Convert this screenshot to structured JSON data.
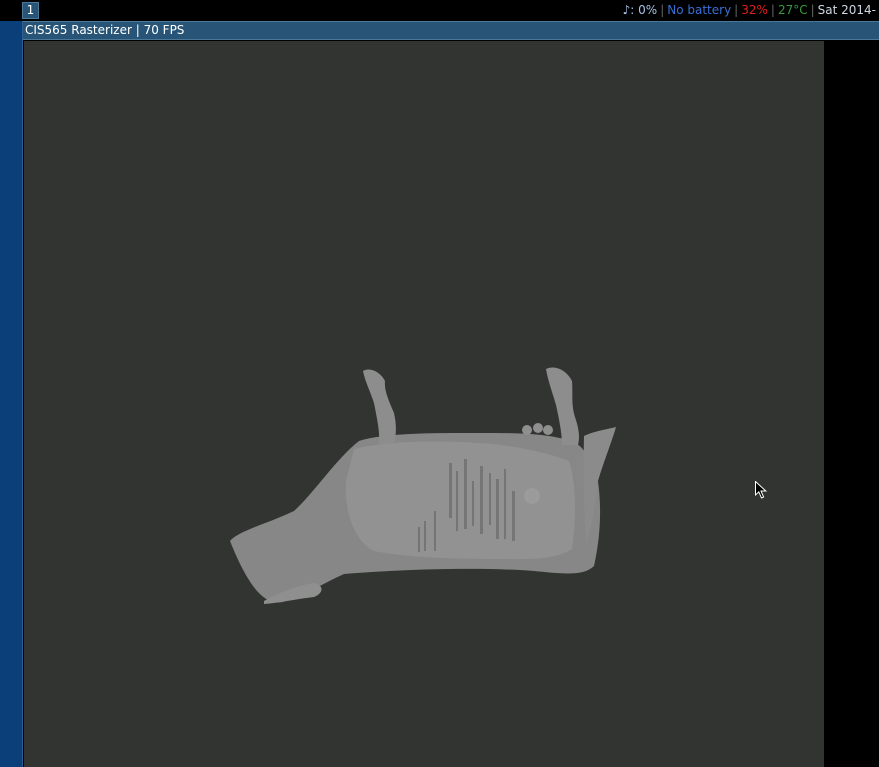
{
  "bar": {
    "workspace_label": "1",
    "status": {
      "volume": "♪: 0%",
      "battery": "No battery",
      "cpu": "32%",
      "temp": "27°C",
      "datetime": "Sat 2014-"
    },
    "colors": {
      "volume": "#a8c4e8",
      "battery": "#3a6fd8",
      "cpu": "#e0201e",
      "temp": "#3a9a3a",
      "datetime": "#cfd8e3"
    }
  },
  "window": {
    "title": "CIS565 Rasterizer | 70 FPS"
  },
  "icons": {
    "cursor": "mouse-pointer-icon"
  }
}
